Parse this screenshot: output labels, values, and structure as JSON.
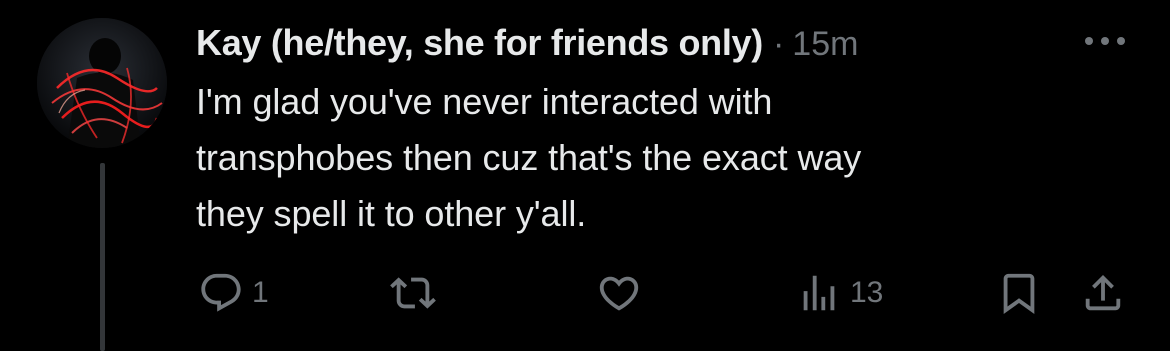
{
  "tweet": {
    "display_name": "Kay (he/they, she for friends only)",
    "separator": "·",
    "timestamp": "15m",
    "text_lines": [
      "I'm glad you've never interacted with",
      "transphobes then cuz that's the exact way",
      "they spell it to other y'all."
    ]
  },
  "actions": {
    "reply_count": "1",
    "views_count": "13"
  },
  "icons": {
    "more": "more-dots-icon",
    "reply": "reply-bubble-icon",
    "retweet": "retweet-icon",
    "like": "heart-icon",
    "views": "views-bar-chart-icon",
    "bookmark": "bookmark-icon",
    "share": "share-upload-icon"
  },
  "colors": {
    "background": "#000000",
    "text": "#e7e9ea",
    "secondary": "#71767b",
    "thread_line": "#333639",
    "avatar_accent": "#ff2a2a"
  }
}
